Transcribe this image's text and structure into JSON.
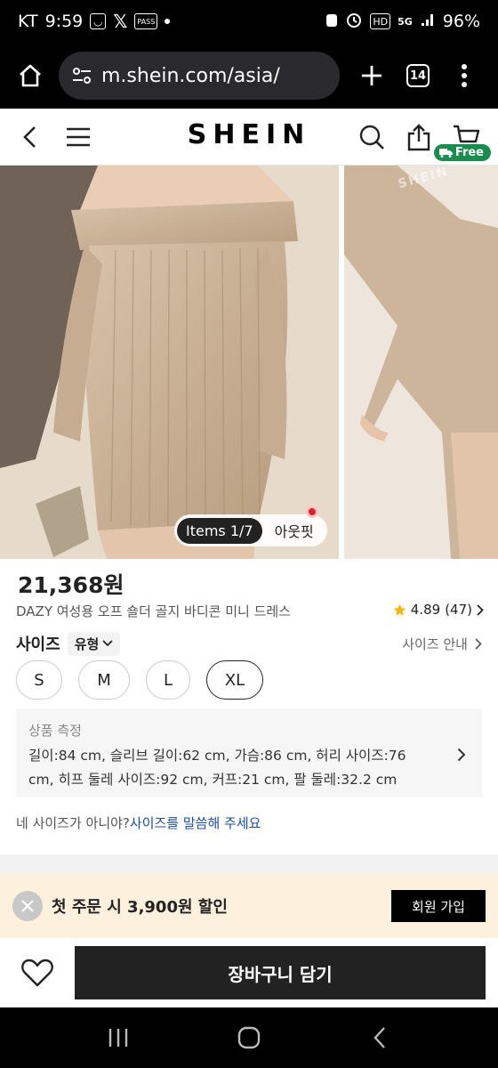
{
  "status_bar": {
    "carrier": "KT",
    "time": "9:59",
    "left_icons": [
      "smile-app-icon",
      "x-icon",
      "pass-icon"
    ],
    "pass_label": "PASS",
    "hd_label": "HD",
    "network_label": "5G",
    "battery": "96%"
  },
  "browser": {
    "url": "m.shein.com/asia/",
    "tab_count": "14"
  },
  "site_header": {
    "logo": "SHEIN",
    "free_badge": "Free"
  },
  "gallery": {
    "items_count": "Items 1/7",
    "outfit_label": "아웃핏",
    "watermark": "SHEIN"
  },
  "product": {
    "price": "21,368원",
    "name": "DAZY 여성용 오프 숄더 골지 바디콘 미니 드레스",
    "rating": "4.89",
    "review_count": "(47)",
    "size_label": "사이즈",
    "type_chip": "유형",
    "size_guide": "사이즈 안내",
    "sizes": [
      "S",
      "M",
      "L",
      "XL"
    ],
    "selected_size": "XL",
    "measure_title": "상품 측정",
    "measure_line1": "길이:84 cm,  슬리브 길이:62 cm,  가슴:86 cm,  허리 사이즈:76",
    "measure_line2": "cm,  히프 둘레 사이즈:92 cm,  커프:21 cm,  팔 둘레:32.2 cm",
    "size_help_prefix": "네 사이즈가 아니야?",
    "size_help_link": "사이즈를 말씀해 주세요"
  },
  "promo": {
    "text": "첫 주문 시 3,900원 할인",
    "join_button": "회원 가입"
  },
  "actions": {
    "add_to_cart": "장바구니 담기"
  },
  "colors": {
    "accent_green": "#198c4e",
    "dark": "#222222",
    "promo_bg": "#fdf0dd",
    "link_blue": "#1a4fa0"
  }
}
